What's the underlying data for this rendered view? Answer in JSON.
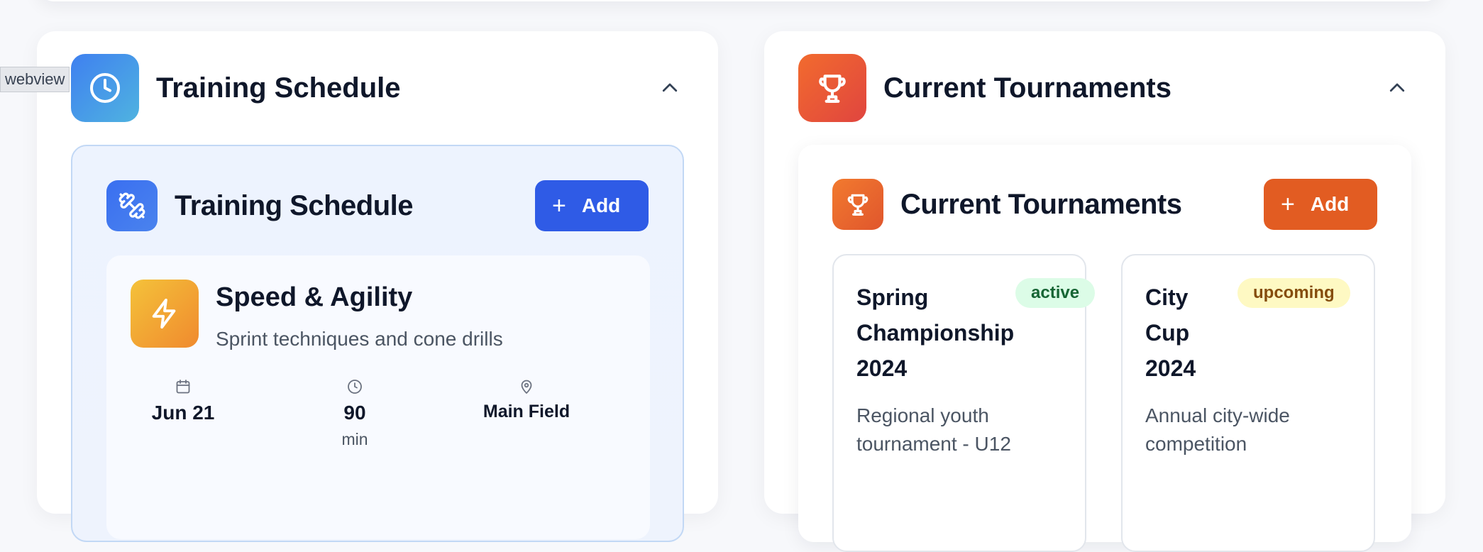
{
  "webview_label": "webview",
  "training": {
    "panel_title": "Training Schedule",
    "section_title": "Training Schedule",
    "add_label": "Add",
    "session": {
      "title": "Speed & Agility",
      "description": "Sprint techniques and cone drills",
      "date": "Jun 21",
      "duration": "90",
      "duration_unit": "min",
      "location": "Main Field"
    }
  },
  "tournaments": {
    "panel_title": "Current Tournaments",
    "section_title": "Current Tournaments",
    "add_label": "Add",
    "items": [
      {
        "name_lines": [
          "Spring",
          "Championship",
          "2024"
        ],
        "status": "active",
        "description_lines": [
          "Regional youth",
          "tournament - U12"
        ]
      },
      {
        "name_lines": [
          "City",
          "Cup",
          "2024"
        ],
        "status": "upcoming",
        "description_lines": [
          "Annual city-wide",
          "competition"
        ]
      }
    ]
  },
  "icons": {
    "training_header": "clock-icon",
    "training_section": "dumbbell-icon",
    "session": "lightning-icon",
    "tournament_header": "trophy-icon",
    "tournament_section": "trophy-icon",
    "collapse": "chevron-up-icon",
    "date": "calendar-icon",
    "duration": "clock-icon",
    "location": "map-pin-icon"
  },
  "colors": {
    "primary_blue": "#2f5be6",
    "accent_orange": "#e25c22",
    "active_badge": "#dcfce7",
    "upcoming_badge": "#fef9c3"
  }
}
